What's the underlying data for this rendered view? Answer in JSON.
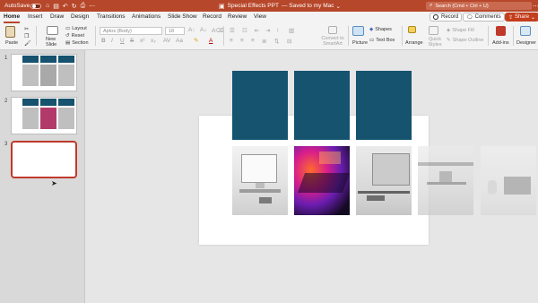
{
  "titlebar": {
    "autosave_label": "AutoSave",
    "document_title": "Special Effects PPT",
    "saved_status": "— Saved to my Mac",
    "search_placeholder": "Search (Cmd + Ctrl + U)"
  },
  "menu": {
    "tabs": [
      "Home",
      "Insert",
      "Draw",
      "Design",
      "Transitions",
      "Animations",
      "Slide Show",
      "Record",
      "Review",
      "View"
    ],
    "record_label": "Record",
    "comments_label": "Comments",
    "share_label": "Share"
  },
  "ribbon": {
    "paste": "Paste",
    "new_slide": "New\nSlide",
    "layout": "Layout",
    "reset": "Reset",
    "section": "Section",
    "font_name": "Aptos (Body)",
    "font_size": "18",
    "convert_smartart": "Convert to SmartArt",
    "picture": "Picture",
    "shapes": "Shapes",
    "text_box": "Text Box",
    "arrange": "Arrange",
    "quick_styles": "Quick Styles",
    "shape_fill": "Shape Fill",
    "shape_outline": "Shape Outline",
    "add_ins": "Add-ins",
    "designer": "Designer"
  },
  "slides": {
    "numbers": [
      "1",
      "2",
      "3"
    ],
    "active": 3
  },
  "colors": {
    "accent": "#b7472a",
    "slide_block": "#15536f",
    "selection": "#c0392b"
  }
}
